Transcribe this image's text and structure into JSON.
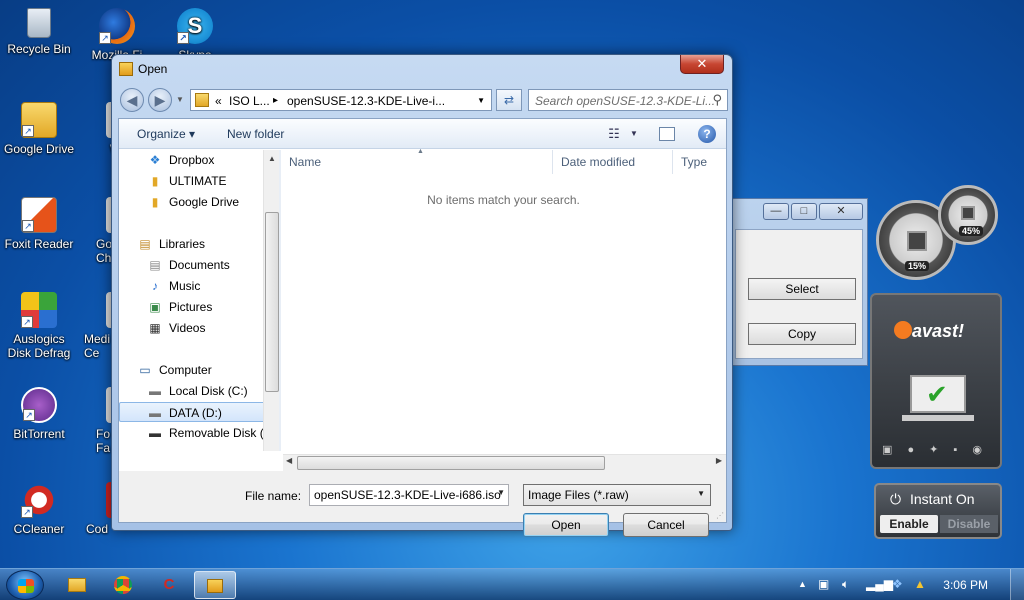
{
  "desktop": {
    "icons": [
      {
        "label": "Recycle Bin"
      },
      {
        "label": "Mozilla Fi"
      },
      {
        "label": "Skype"
      },
      {
        "label": "Google Drive"
      },
      {
        "label": "We"
      },
      {
        "label": "Foxit Reader"
      },
      {
        "label": "Go Ch"
      },
      {
        "label": "Auslogics Disk Defrag"
      },
      {
        "label": "Medi Ce"
      },
      {
        "label": "BitTorrent"
      },
      {
        "label": "Fo Fa"
      },
      {
        "label": "CCleaner"
      },
      {
        "label": "Cod"
      }
    ]
  },
  "background_window": {
    "minimize": "—",
    "maximize": "□",
    "close": "✕",
    "select_button": "Select",
    "copy_button": "Copy"
  },
  "gadgets": {
    "cpu_percent": "15%",
    "mem_percent": "45%",
    "avast_logo": "avast!",
    "instant_on_label": "Instant On",
    "enable_label": "Enable",
    "disable_label": "Disable"
  },
  "dialog": {
    "title": "Open",
    "close_label": "✕",
    "address": {
      "prefix": "«",
      "crumb1": "ISO L...",
      "separator": "▸",
      "crumb2": "openSUSE-12.3-KDE-Live-i..."
    },
    "search_placeholder": "Search openSUSE-12.3-KDE-Li...",
    "toolbar": {
      "organize": "Organize ▾",
      "new_folder": "New folder"
    },
    "nav": [
      {
        "label": "Dropbox",
        "icon": "❖"
      },
      {
        "label": "ULTIMATE",
        "icon": "▮"
      },
      {
        "label": "Google Drive",
        "icon": "▮"
      },
      {
        "label": "Libraries",
        "icon": "▤"
      },
      {
        "label": "Documents",
        "icon": "▤"
      },
      {
        "label": "Music",
        "icon": "♪"
      },
      {
        "label": "Pictures",
        "icon": "▣"
      },
      {
        "label": "Videos",
        "icon": "▦"
      },
      {
        "label": "Computer",
        "icon": "▭"
      },
      {
        "label": "Local Disk (C:)",
        "icon": "▬"
      },
      {
        "label": "DATA (D:)",
        "icon": "▬"
      },
      {
        "label": "Removable Disk (",
        "icon": "▬"
      }
    ],
    "columns": {
      "name": "Name",
      "date_modified": "Date modified",
      "type": "Type"
    },
    "empty_message": "No items match your search.",
    "file_name_label": "File name:",
    "file_name_value": "openSUSE-12.3-KDE-Live-i686.iso",
    "file_type_value": "Image Files (*.raw)",
    "open_button": "Open",
    "cancel_button": "Cancel"
  },
  "taskbar": {
    "clock": "3:06 PM"
  }
}
